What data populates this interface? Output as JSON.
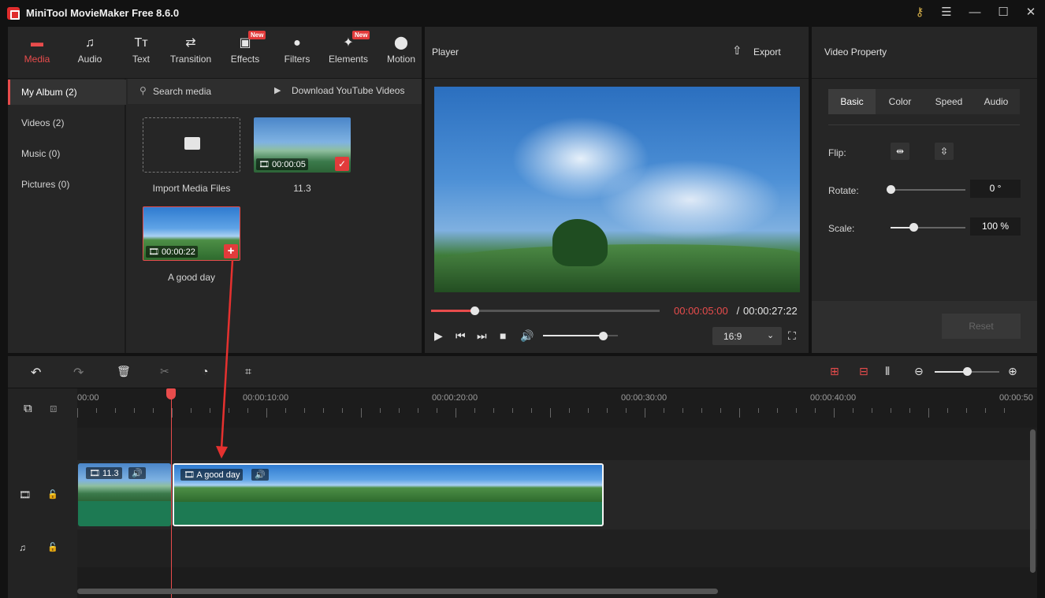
{
  "window": {
    "title": "MiniTool MovieMaker Free 8.6.0"
  },
  "media_tabs": [
    {
      "label": "Media",
      "icon": "folder-icon",
      "active": true
    },
    {
      "label": "Audio",
      "icon": "music-note-icon"
    },
    {
      "label": "Text",
      "icon": "text-icon"
    },
    {
      "label": "Transition",
      "icon": "transition-arrows-icon"
    },
    {
      "label": "Effects",
      "icon": "effects-icon",
      "badge": "New"
    },
    {
      "label": "Filters",
      "icon": "filters-icon"
    },
    {
      "label": "Elements",
      "icon": "elements-icon",
      "badge": "New"
    },
    {
      "label": "Motion",
      "icon": "motion-icon"
    }
  ],
  "album": [
    {
      "label": "My Album (2)",
      "active": true
    },
    {
      "label": "Videos (2)"
    },
    {
      "label": "Music (0)"
    },
    {
      "label": "Pictures (0)"
    }
  ],
  "media_toolbar": {
    "search": "Search media",
    "download": "Download YouTube Videos"
  },
  "media_items": [
    {
      "label": "Import Media Files"
    },
    {
      "label": "11.3",
      "duration": "00:00:05",
      "status": "added"
    },
    {
      "label": "A good day",
      "duration": "00:00:22",
      "status": "add"
    }
  ],
  "player": {
    "title": "Player",
    "export": "Export",
    "current_time": "00:00:05:00",
    "separator": " / ",
    "total_time": "00:00:27:22",
    "progress": 0.19,
    "volume": 0.8,
    "aspect": "16:9"
  },
  "property": {
    "title": "Video Property",
    "tabs": [
      "Basic",
      "Color",
      "Speed",
      "Audio"
    ],
    "flip_label": "Flip:",
    "rotate_label": "Rotate:",
    "rotate_value": "0 °",
    "rotate_level": 0,
    "scale_label": "Scale:",
    "scale_value": "100 %",
    "scale_level": 0.3,
    "reset": "Reset"
  },
  "timeline": {
    "ruler": [
      "00:00",
      "00:00:10:00",
      "00:00:20:00",
      "00:00:30:00",
      "00:00:40:00",
      "00:00:50"
    ],
    "clips": [
      {
        "label": "11.3"
      },
      {
        "label": "A good day"
      }
    ],
    "zoom_level": 0.5
  },
  "colors": {
    "accent": "#e84c4c",
    "clip_green": "#1d7a53"
  }
}
